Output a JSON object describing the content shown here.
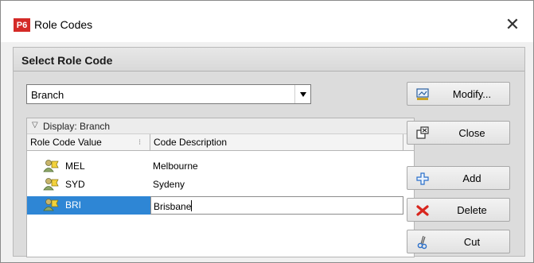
{
  "window": {
    "app_icon_text": "P6",
    "title": "Role Codes",
    "close_glyph": "✕"
  },
  "panel": {
    "title": "Select Role Code"
  },
  "role_code_select": {
    "value": "Branch"
  },
  "buttons": {
    "modify": "Modify...",
    "close": "Close",
    "add": "Add",
    "delete": "Delete",
    "cut": "Cut"
  },
  "grid": {
    "group_label": "Display: Branch",
    "columns": [
      "Role Code Value",
      "Code Description"
    ],
    "rows": [
      {
        "code": "MEL",
        "description": "Melbourne",
        "selected": false
      },
      {
        "code": "SYD",
        "description": "Sydeny",
        "selected": false
      },
      {
        "code": "BRI",
        "description": "Brisbane",
        "selected": true
      }
    ]
  },
  "colors": {
    "selection": "#2e86d5",
    "app_icon": "#d42a27",
    "delete_icon": "#d8261e",
    "add_icon": "#2a6fc9"
  },
  "icons": {
    "app": "p6-app-icon",
    "close": "close-icon",
    "modify": "modify-icon",
    "close_dialog": "close-dialog-icon",
    "add": "plus-icon",
    "delete": "delete-x-icon",
    "cut": "scissors-icon",
    "row": "role-people-icon"
  }
}
